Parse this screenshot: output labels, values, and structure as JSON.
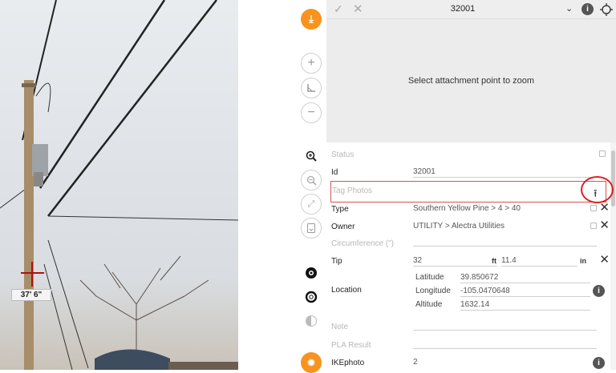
{
  "photo": {
    "height_label": "37' 6\""
  },
  "topbar": {
    "title": "32001"
  },
  "preview": {
    "message": "Select attachment point to zoom"
  },
  "form": {
    "status_label": "Status",
    "id_label": "Id",
    "id_value": "32001",
    "tag_photos_label": "Tag Photos",
    "type_label": "Type",
    "type_value": "Southern Yellow Pine > 4 > 40",
    "owner_label": "Owner",
    "owner_value": "UTILITY > Alectra Utilities",
    "circumference_label": "Circumference (\")",
    "tip_label": "Tip",
    "tip_ft_value": "32",
    "tip_ft_unit": "ft",
    "tip_in_value": "11.4",
    "tip_in_unit": "in",
    "location_label": "Location",
    "latitude_label": "Latitude",
    "latitude_value": "39.850672",
    "longitude_label": "Longitude",
    "longitude_value": "-105.0470648",
    "altitude_label": "Altitude",
    "altitude_value": "1632.14",
    "note_label": "Note",
    "pla_label": "PLA Result",
    "ikephoto_label": "IKEphoto",
    "ikephoto_value": "2"
  },
  "colors": {
    "accent": "#f7931e",
    "highlight": "#e02020"
  },
  "icons": [
    "download-icon",
    "zoom-in-plus-icon",
    "measure-angle-icon",
    "zoom-out-minus-icon",
    "magnify-plus-icon",
    "magnify-minus-icon",
    "fit-screen-icon",
    "rotate-icon",
    "settings-gear-icon",
    "gear-outline-icon",
    "brightness-icon",
    "sun-icon",
    "check-icon",
    "close-icon",
    "chevron-down-icon",
    "info-icon",
    "crosshair-icon",
    "upload-icon"
  ]
}
